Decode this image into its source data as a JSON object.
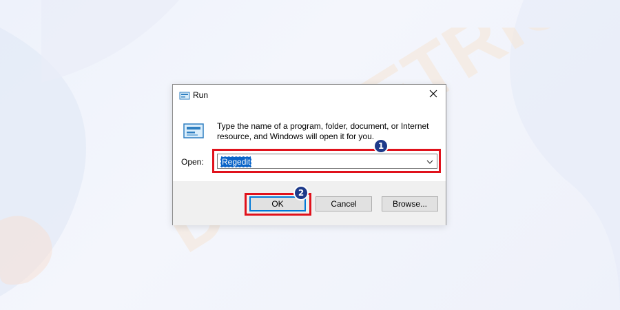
{
  "watermark": {
    "text": "DEVICETRICKS"
  },
  "dialog": {
    "title": "Run",
    "description": "Type the name of a program, folder, document, or Internet resource, and Windows will open it for you.",
    "open_label": "Open:",
    "open_value": "Regedit",
    "buttons": {
      "ok": "OK",
      "cancel": "Cancel",
      "browse": "Browse..."
    }
  },
  "annotations": [
    {
      "number": "1",
      "target": "open-combobox",
      "color": "#e0121c"
    },
    {
      "number": "2",
      "target": "ok-button",
      "color": "#e0121c"
    }
  ],
  "icons": {
    "title": "run-icon",
    "dialog": "run-icon",
    "close": "close-icon",
    "dropdown": "chevron-down-icon"
  },
  "colors": {
    "highlight": "#e0121c",
    "badge": "#1e3a8a",
    "selection": "#0a64c8",
    "accent": "#0078d7"
  }
}
